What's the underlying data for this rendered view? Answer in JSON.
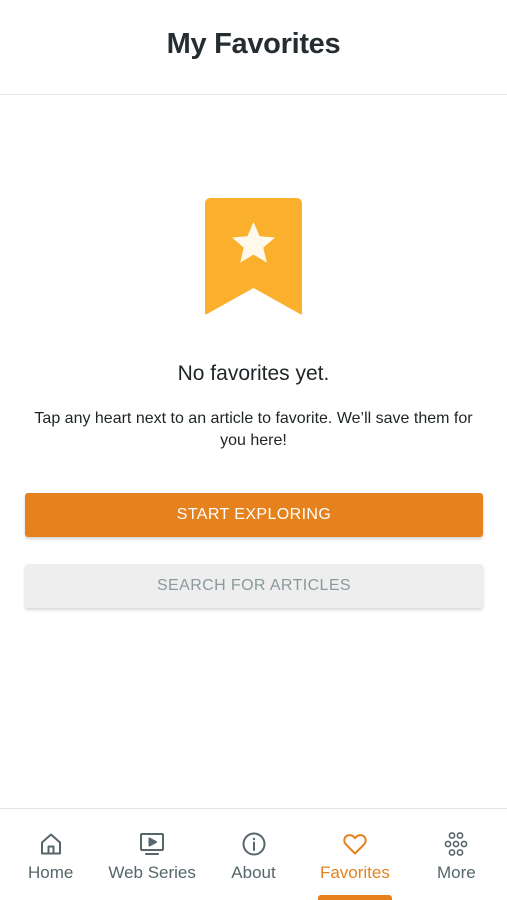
{
  "header": {
    "title": "My Favorites"
  },
  "empty_state": {
    "icon": "bookmark-star-icon",
    "title": "No favorites yet.",
    "description": "Tap any heart next to an article to favorite. We’ll save them for you here!"
  },
  "actions": {
    "primary_label": "START EXPLORING",
    "secondary_label": "SEARCH FOR ARTICLES"
  },
  "tabs": [
    {
      "label": "Home",
      "icon": "home-icon",
      "active": false
    },
    {
      "label": "Web Series",
      "icon": "play-screen-icon",
      "active": false
    },
    {
      "label": "About",
      "icon": "info-icon",
      "active": false
    },
    {
      "label": "Favorites",
      "icon": "heart-icon",
      "active": true
    },
    {
      "label": "More",
      "icon": "more-grid-icon",
      "active": false
    }
  ],
  "colors": {
    "accent": "#e6821e",
    "bookmark": "#fbb02d",
    "secondary_button_bg": "#eeeeee",
    "secondary_button_text": "#8a9a9c",
    "tab_inactive": "#56666a"
  }
}
